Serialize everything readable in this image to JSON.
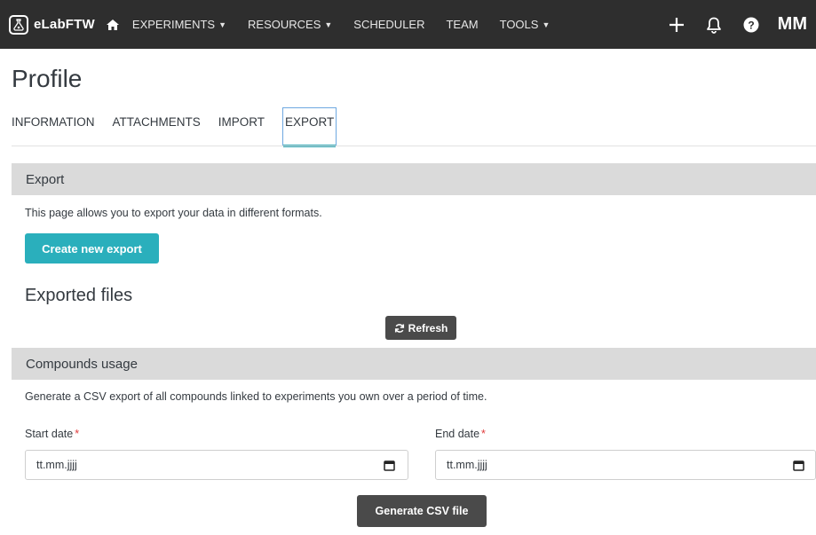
{
  "navbar": {
    "brand": "eLabFTW",
    "links": [
      {
        "label": "EXPERIMENTS",
        "dropdown": true
      },
      {
        "label": "RESOURCES",
        "dropdown": true
      },
      {
        "label": "SCHEDULER",
        "dropdown": false
      },
      {
        "label": "TEAM",
        "dropdown": false
      },
      {
        "label": "TOOLS",
        "dropdown": true
      }
    ],
    "user_initials": "MM",
    "background_color": "#2e2e2e",
    "icons": [
      "home-icon",
      "plus-icon",
      "bell-icon",
      "help-icon"
    ]
  },
  "page": {
    "title": "Profile",
    "tabs": [
      {
        "label": "INFORMATION",
        "active": false
      },
      {
        "label": "ATTACHMENTS",
        "active": false
      },
      {
        "label": "IMPORT",
        "active": false
      },
      {
        "label": "EXPORT",
        "active": true
      }
    ]
  },
  "export": {
    "header": "Export",
    "description": "This page allows you to export your data in different formats.",
    "create_button": "Create new export",
    "exported_heading": "Exported files",
    "refresh_button": "Refresh"
  },
  "compounds": {
    "header": "Compounds usage",
    "description": "Generate a CSV export of all compounds linked to experiments you own over a period of time.",
    "start_label": "Start date",
    "end_label": "End date",
    "required_mark": "*",
    "start_value": "tt.mm.jjjj",
    "end_value": "tt.mm.jjjj",
    "generate_button": "Generate CSV file"
  },
  "colors": {
    "accent": "#2aafbc",
    "section_bg": "#dadada",
    "dark_button": "#4a4a4a",
    "required": "#e03b3b"
  }
}
